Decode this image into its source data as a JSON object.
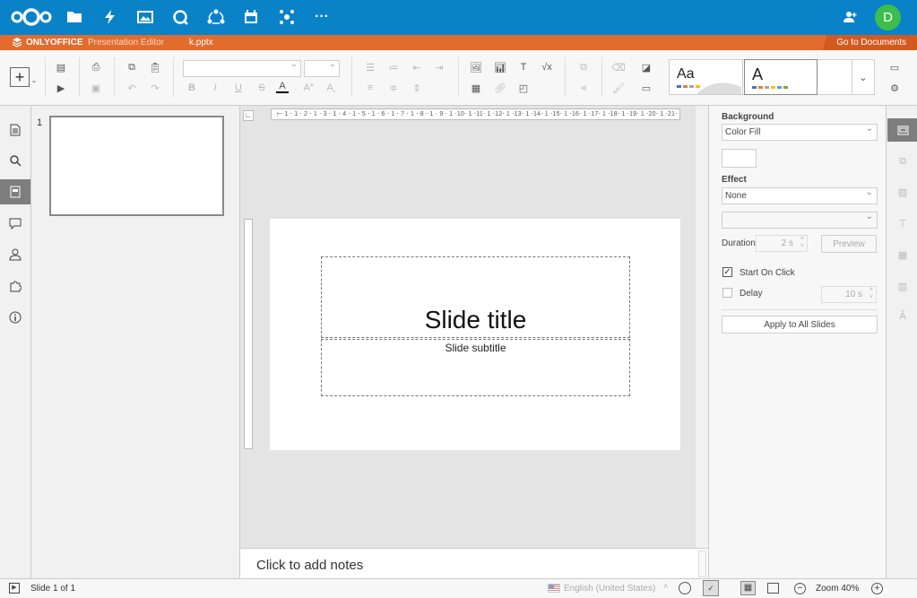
{
  "nextcloud": {
    "avatar_letter": "D",
    "apps": [
      "files-icon",
      "activity-icon",
      "photos-icon",
      "talk-icon",
      "circles-icon",
      "calendar-icon",
      "deck-icon",
      "more-icon"
    ]
  },
  "onlyoffice": {
    "brand": "ONLYOFFICE",
    "editor_name": "Presentation Editor",
    "file_name": "k.pptx",
    "go_to_documents": "Go to Documents"
  },
  "theme_preview": {
    "first": "Aa",
    "second": "A"
  },
  "thumbnails": [
    {
      "number": "1"
    }
  ],
  "slide": {
    "title": "Slide title",
    "subtitle": "Slide subtitle"
  },
  "ruler_h": "⊢ 1 ⋅ 1 ⋅ 2 ⋅ 1 ⋅ 3 ⋅ 1 ⋅ 4 ⋅ 1 ⋅ 5 ⋅ 1 ⋅ 6 ⋅ 1 ⋅ 7 ⋅ 1 ⋅ 8 ⋅ 1 ⋅ 9 ⋅ 1 ⋅10⋅ 1 ⋅11⋅ 1 ⋅12⋅ 1 ⋅13⋅ 1 ⋅14⋅ 1 ⋅15⋅ 1 ⋅16⋅ 1 ⋅17⋅ 1 ⋅18⋅ 1 ⋅19⋅ 1 ⋅20⋅ 1 ⋅21⋅ 1 ⋅22⋅ 1 ⋅23⋅ 1 ⋅24⋅ 1 ⋅25⋅ 1 ⋅26⋅ 1 ⋅27⋅ 1 ⋅28⋅ 1 ⋅29⋅ 1 ⋅30⋅ 1 ⋅31⋅ 1 ⋅32⋅ 1 ⋅33⋅ 1",
  "notes_placeholder": "Click to add notes",
  "right_panel": {
    "background_label": "Background",
    "background_value": "Color Fill",
    "effect_label": "Effect",
    "effect_value": "None",
    "effect_type_value": "",
    "duration_label": "Duration",
    "duration_value": "2 s",
    "preview_label": "Preview",
    "start_on_click_label": "Start On Click",
    "start_on_click_checked": "✓",
    "delay_label": "Delay",
    "delay_value": "10 s",
    "apply_all_label": "Apply to All Slides"
  },
  "statusbar": {
    "slide_counter": "Slide 1 of 1",
    "language": "English (United States)",
    "zoom": "Zoom 40%"
  },
  "colors": {
    "nextcloud_blue": "#0a82c8",
    "onlyoffice_orange": "#e26b2e",
    "avatar_green": "#3dbd4c"
  }
}
